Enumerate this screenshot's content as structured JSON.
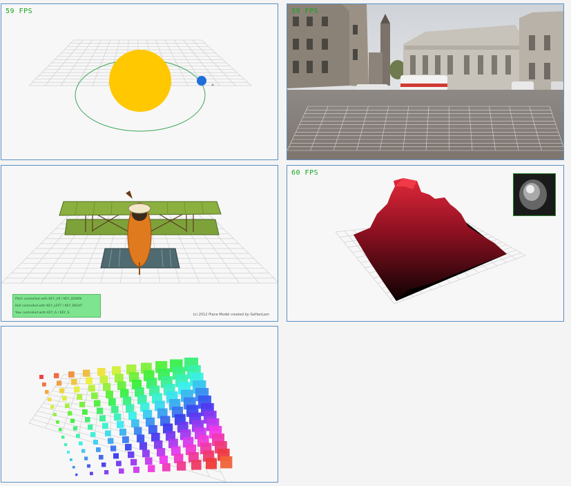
{
  "panels": {
    "solar": {
      "fps": "59 FPS"
    },
    "street": {
      "fps": "59 FPS"
    },
    "plane": {
      "controls": [
        "Pitch controlled with KEY_UP / KEY_DOWN",
        "Roll controlled with KEY_LEFT / KEY_RIGHT",
        "Yaw controlled with KEY_A / KEY_S"
      ],
      "credit": "(c) 2012 Plane Model created by GeHanLam"
    },
    "terrain": {
      "fps": "60 FPS"
    },
    "cubes": {}
  },
  "colors": {
    "fps_text": "#17a51d",
    "panel_border": "#5b8fc4",
    "sun": "#ffc800",
    "planet": "#1e6fd9",
    "orbit": "#3aa55a"
  }
}
